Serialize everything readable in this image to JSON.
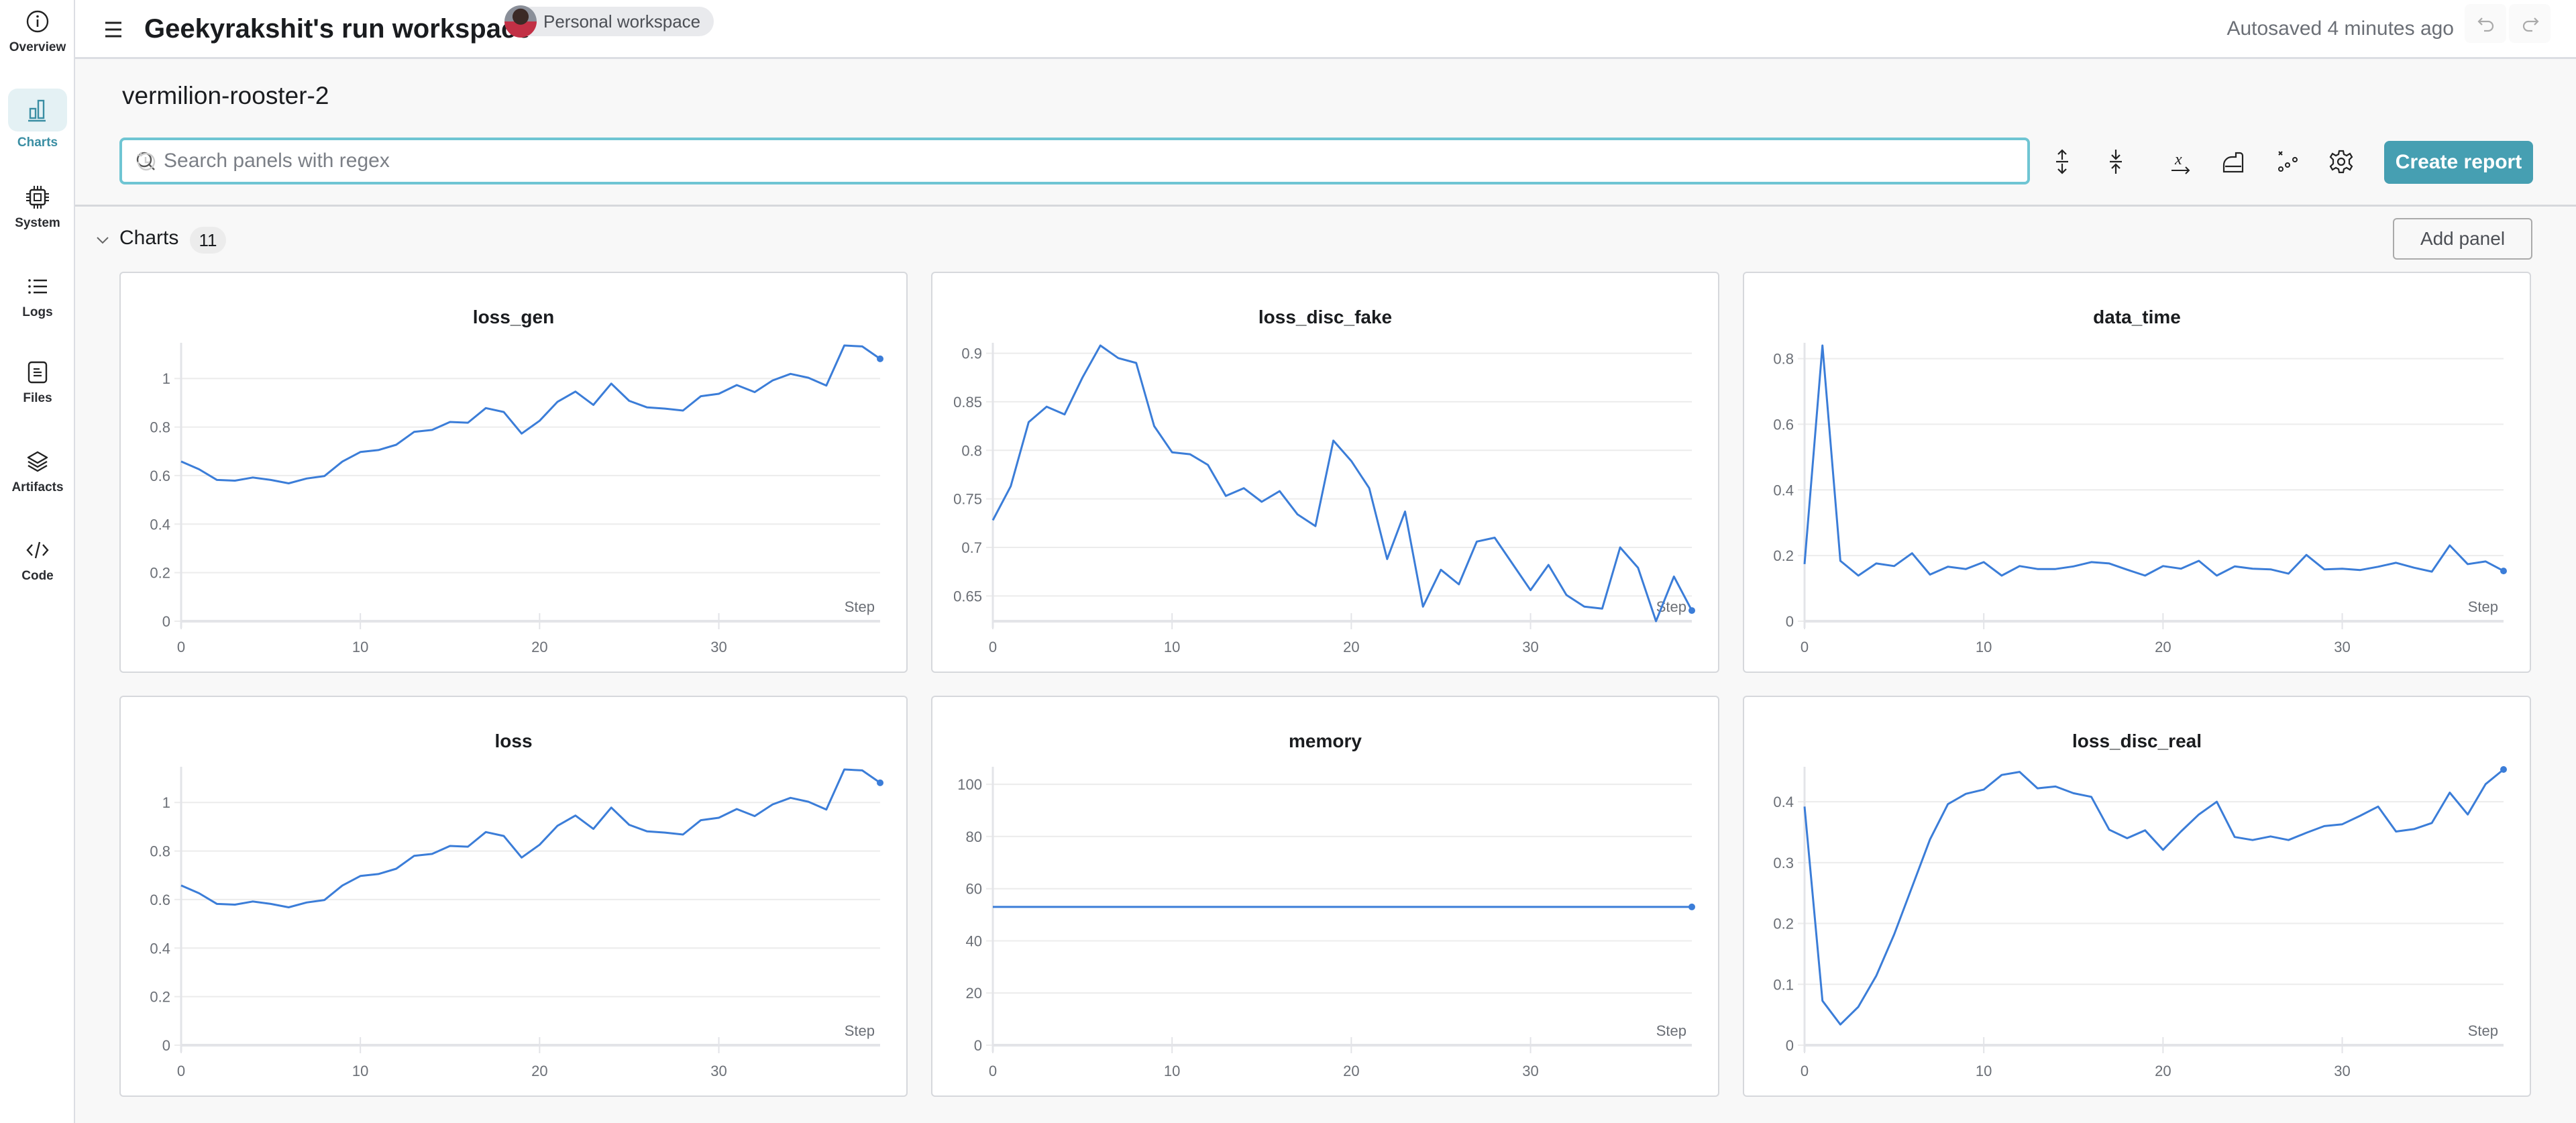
{
  "sidebar": {
    "items": [
      {
        "label": "Overview",
        "icon": "info-icon"
      },
      {
        "label": "Charts",
        "icon": "bar-chart-icon",
        "active": true
      },
      {
        "label": "System",
        "icon": "chip-icon"
      },
      {
        "label": "Logs",
        "icon": "list-icon"
      },
      {
        "label": "Files",
        "icon": "file-icon"
      },
      {
        "label": "Artifacts",
        "icon": "layers-icon"
      },
      {
        "label": "Code",
        "icon": "code-icon"
      }
    ]
  },
  "header": {
    "title": "Geekyrakshit's run workspace",
    "workspace_badge": "Personal workspace",
    "autosave": "Autosaved 4 minutes ago"
  },
  "run_name": "vermilion-rooster-2",
  "search": {
    "placeholder": "Search panels with regex",
    "value": ""
  },
  "toolbar": {
    "create_report": "Create report"
  },
  "section": {
    "title": "Charts",
    "count": "11",
    "add_panel": "Add panel"
  },
  "colors": {
    "accent": "#469fb2",
    "line": "#3b7dd8",
    "search_border": "#6fc5d3"
  },
  "chart_data": [
    {
      "type": "line",
      "title": "loss_gen",
      "xlabel": "Step",
      "xlim": [
        0,
        39
      ],
      "ylim": [
        0,
        1.136
      ],
      "yticks": [
        "0",
        "0.2",
        "0.4",
        "0.6",
        "0.8",
        "1"
      ],
      "ytick_values": [
        0,
        0.2,
        0.4,
        0.6,
        0.8,
        1
      ],
      "xticks": [
        0,
        10,
        20,
        30
      ],
      "x": [
        0,
        1,
        2,
        3,
        4,
        5,
        6,
        7,
        8,
        9,
        10,
        11,
        12,
        13,
        14,
        15,
        16,
        17,
        18,
        19,
        20,
        21,
        22,
        23,
        24,
        25,
        26,
        27,
        28,
        29,
        30,
        31,
        32,
        33,
        34,
        35,
        36,
        37,
        38,
        39
      ],
      "y": [
        0.658,
        0.626,
        0.582,
        0.579,
        0.592,
        0.582,
        0.568,
        0.588,
        0.598,
        0.658,
        0.697,
        0.705,
        0.727,
        0.78,
        0.788,
        0.821,
        0.818,
        0.878,
        0.862,
        0.773,
        0.826,
        0.904,
        0.946,
        0.891,
        0.979,
        0.908,
        0.881,
        0.876,
        0.868,
        0.927,
        0.937,
        0.973,
        0.944,
        0.992,
        1.019,
        1.003,
        0.971,
        1.136,
        1.132,
        1.081
      ]
    },
    {
      "type": "line",
      "title": "loss_disc_fake",
      "xlabel": "Step",
      "xlim": [
        0,
        39
      ],
      "ylim": [
        0.624,
        0.908
      ],
      "yticks": [
        "0.65",
        "0.7",
        "0.75",
        "0.8",
        "0.85",
        "0.9"
      ],
      "ytick_values": [
        0.65,
        0.7,
        0.75,
        0.8,
        0.85,
        0.9
      ],
      "xticks": [
        0,
        10,
        20,
        30
      ],
      "x": [
        0,
        1,
        2,
        3,
        4,
        5,
        6,
        7,
        8,
        9,
        10,
        11,
        12,
        13,
        14,
        15,
        16,
        17,
        18,
        19,
        20,
        21,
        22,
        23,
        24,
        25,
        26,
        27,
        28,
        29,
        30,
        31,
        32,
        33,
        34,
        35,
        36,
        37,
        38,
        39
      ],
      "y": [
        0.728,
        0.763,
        0.829,
        0.845,
        0.837,
        0.875,
        0.908,
        0.895,
        0.89,
        0.825,
        0.798,
        0.796,
        0.785,
        0.753,
        0.761,
        0.747,
        0.758,
        0.734,
        0.722,
        0.81,
        0.789,
        0.761,
        0.688,
        0.737,
        0.639,
        0.677,
        0.662,
        0.706,
        0.71,
        0.683,
        0.656,
        0.682,
        0.651,
        0.639,
        0.637,
        0.7,
        0.679,
        0.624,
        0.67,
        0.635
      ]
    },
    {
      "type": "line",
      "title": "data_time",
      "xlabel": "Step",
      "xlim": [
        0,
        39
      ],
      "ylim": [
        0,
        0.84
      ],
      "yticks": [
        "0",
        "0.2",
        "0.4",
        "0.6",
        "0.8"
      ],
      "ytick_values": [
        0,
        0.2,
        0.4,
        0.6,
        0.8
      ],
      "xticks": [
        0,
        10,
        20,
        30
      ],
      "x": [
        0,
        1,
        2,
        3,
        4,
        5,
        6,
        7,
        8,
        9,
        10,
        11,
        12,
        13,
        14,
        15,
        16,
        17,
        18,
        19,
        20,
        21,
        22,
        23,
        24,
        25,
        26,
        27,
        28,
        29,
        30,
        31,
        32,
        33,
        34,
        35,
        36,
        37,
        38,
        39
      ],
      "y": [
        0.174,
        0.84,
        0.184,
        0.139,
        0.176,
        0.168,
        0.207,
        0.142,
        0.166,
        0.159,
        0.18,
        0.139,
        0.168,
        0.159,
        0.159,
        0.167,
        0.18,
        0.176,
        0.157,
        0.139,
        0.168,
        0.16,
        0.184,
        0.139,
        0.167,
        0.16,
        0.158,
        0.145,
        0.202,
        0.158,
        0.16,
        0.156,
        0.166,
        0.178,
        0.163,
        0.151,
        0.231,
        0.174,
        0.182,
        0.153
      ]
    },
    {
      "type": "line",
      "title": "loss",
      "xlabel": "Step",
      "xlim": [
        0,
        39
      ],
      "ylim": [
        0,
        1.136
      ],
      "yticks": [
        "0",
        "0.2",
        "0.4",
        "0.6",
        "0.8",
        "1"
      ],
      "ytick_values": [
        0,
        0.2,
        0.4,
        0.6,
        0.8,
        1
      ],
      "xticks": [
        0,
        10,
        20,
        30
      ],
      "x": [
        0,
        1,
        2,
        3,
        4,
        5,
        6,
        7,
        8,
        9,
        10,
        11,
        12,
        13,
        14,
        15,
        16,
        17,
        18,
        19,
        20,
        21,
        22,
        23,
        24,
        25,
        26,
        27,
        28,
        29,
        30,
        31,
        32,
        33,
        34,
        35,
        36,
        37,
        38,
        39
      ],
      "y": [
        0.658,
        0.626,
        0.582,
        0.579,
        0.592,
        0.582,
        0.568,
        0.588,
        0.598,
        0.658,
        0.697,
        0.705,
        0.727,
        0.78,
        0.788,
        0.821,
        0.818,
        0.878,
        0.862,
        0.773,
        0.826,
        0.904,
        0.946,
        0.891,
        0.979,
        0.908,
        0.881,
        0.876,
        0.868,
        0.927,
        0.937,
        0.973,
        0.944,
        0.992,
        1.019,
        1.003,
        0.971,
        1.136,
        1.132,
        1.081
      ]
    },
    {
      "type": "line",
      "title": "memory",
      "xlabel": "Step",
      "xlim": [
        0,
        39
      ],
      "ylim": [
        0,
        105.7
      ],
      "yticks": [
        "0",
        "20",
        "40",
        "60",
        "80",
        "100"
      ],
      "ytick_values": [
        0,
        20,
        40,
        60,
        80,
        100
      ],
      "xticks": [
        0,
        10,
        20,
        30
      ],
      "x": [
        0,
        1,
        2,
        3,
        4,
        5,
        6,
        7,
        8,
        9,
        10,
        11,
        12,
        13,
        14,
        15,
        16,
        17,
        18,
        19,
        20,
        21,
        22,
        23,
        24,
        25,
        26,
        27,
        28,
        29,
        30,
        31,
        32,
        33,
        34,
        35,
        36,
        37,
        38,
        39
      ],
      "y": [
        53,
        53,
        53,
        53,
        53,
        53,
        53,
        53,
        53,
        53,
        53,
        53,
        53,
        53,
        53,
        53,
        53,
        53,
        53,
        53,
        53,
        53,
        53,
        53,
        53,
        53,
        53,
        53,
        53,
        53,
        53,
        53,
        53,
        53,
        53,
        53,
        53,
        53,
        53,
        53
      ]
    },
    {
      "type": "line",
      "title": "loss_disc_real",
      "xlabel": "Step",
      "xlim": [
        0,
        39
      ],
      "ylim": [
        0,
        0.453
      ],
      "yticks": [
        "0",
        "0.1",
        "0.2",
        "0.3",
        "0.4"
      ],
      "ytick_values": [
        0,
        0.1,
        0.2,
        0.3,
        0.4
      ],
      "xticks": [
        0,
        10,
        20,
        30
      ],
      "x": [
        0,
        1,
        2,
        3,
        4,
        5,
        6,
        7,
        8,
        9,
        10,
        11,
        12,
        13,
        14,
        15,
        16,
        17,
        18,
        19,
        20,
        21,
        22,
        23,
        24,
        25,
        26,
        27,
        28,
        29,
        30,
        31,
        32,
        33,
        34,
        35,
        36,
        37,
        38,
        39
      ],
      "y": [
        0.392,
        0.073,
        0.034,
        0.063,
        0.114,
        0.182,
        0.26,
        0.338,
        0.396,
        0.413,
        0.42,
        0.444,
        0.449,
        0.422,
        0.425,
        0.414,
        0.408,
        0.354,
        0.34,
        0.353,
        0.321,
        0.351,
        0.379,
        0.4,
        0.342,
        0.337,
        0.343,
        0.337,
        0.349,
        0.36,
        0.363,
        0.377,
        0.392,
        0.351,
        0.355,
        0.365,
        0.415,
        0.379,
        0.429,
        0.453
      ]
    }
  ]
}
